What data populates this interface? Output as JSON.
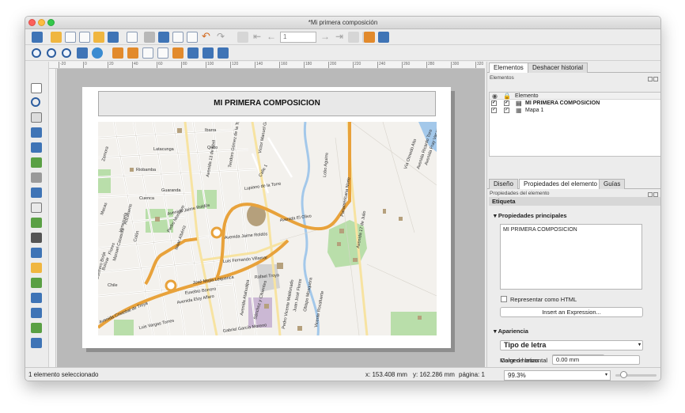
{
  "window": {
    "title": "*Mi primera composición"
  },
  "toolbar": {
    "page_number": "1"
  },
  "ruler": {
    "ticks": [
      "-20",
      "0",
      "20",
      "40",
      "60",
      "80",
      "100",
      "120",
      "140",
      "160",
      "180",
      "200",
      "220",
      "240",
      "260",
      "280",
      "300",
      "320"
    ]
  },
  "composition": {
    "label_text": "MI PRIMERA COMPOSICION",
    "map_labels": [
      "Ibarra",
      "Quito",
      "Latacunga",
      "Zamora",
      "Guaranda",
      "Riobamba",
      "Cuenca",
      "Macas",
      "Avenida Jaime Roldós",
      "Avenida Jaime Roldós",
      "Avenida Cristobal de Troya",
      "Luis Vargas Torres",
      "Avenida Eloy Alfaro",
      "Eusebio Borrero",
      "José Mejía Lequerica",
      "Luis Fernando Villamar",
      "Rafael Troya",
      "Calle 1",
      "Lupiano de la Torre",
      "Teodoro Gómez de la Torre",
      "Panamericana Norte",
      "Avenida 17 de Julio",
      "Avenida 13 de Abril",
      "Lobo Aguirre",
      "Vía Olmedo Alto",
      "Avenida Ricardo Toro",
      "Juan José Flores",
      "Sánchez y Cifuentes",
      "Gabriel García Moreno",
      "Pedro Vicente Maldonado",
      "Obispo Mosquera",
      "Avenida Atahualpa",
      "Vicente Rocafuerte",
      "Víctor Manuel Guzmán",
      "Guerrero Borja",
      "Manuel Casasola",
      "Avenida El Olivo",
      "Pedro Moncayo",
      "Isaac Albéniz",
      "Flores",
      "Bolívar",
      "Chile",
      "Venezuela",
      "Colón",
      "Rocafuerte",
      "Avenida Fray Vacas Galindo"
    ]
  },
  "statusbar": {
    "selection": "1 elemento seleccionado",
    "x": "x: 153.408 mm",
    "y": "y: 162.286 mm",
    "page": "página: 1",
    "zoom": "99.3%"
  },
  "panels": {
    "top_tabs": [
      "Elementos",
      "Deshacer historial"
    ],
    "elements_title": "Elementos",
    "tree_header": "Elemento",
    "items": [
      {
        "label": "MI PRIMERA COMPOSICION",
        "selected": true
      },
      {
        "label": "Mapa 1",
        "selected": false
      }
    ],
    "bottom_tabs": [
      "Diseño",
      "Propiedades del elemento",
      "Guías"
    ],
    "props_title": "Propiedades del elemento",
    "section_label": "Etiqueta",
    "main_props": "Propiedades principales",
    "label_value": "MI PRIMERA COMPOSICION",
    "render_html": "Representar como HTML",
    "insert_expression": "Insert an Expression...",
    "appearance": "Apariencia",
    "font_button": "Tipo de letra",
    "font_color_label": "Color de letras",
    "margin_label": "Margen horizontal",
    "margin_value": "0.00 mm"
  },
  "colors": {
    "accent": "#2c5d9f",
    "road_major": "#e8a23b",
    "park": "#b9deaa",
    "water": "#a3c8ea"
  }
}
